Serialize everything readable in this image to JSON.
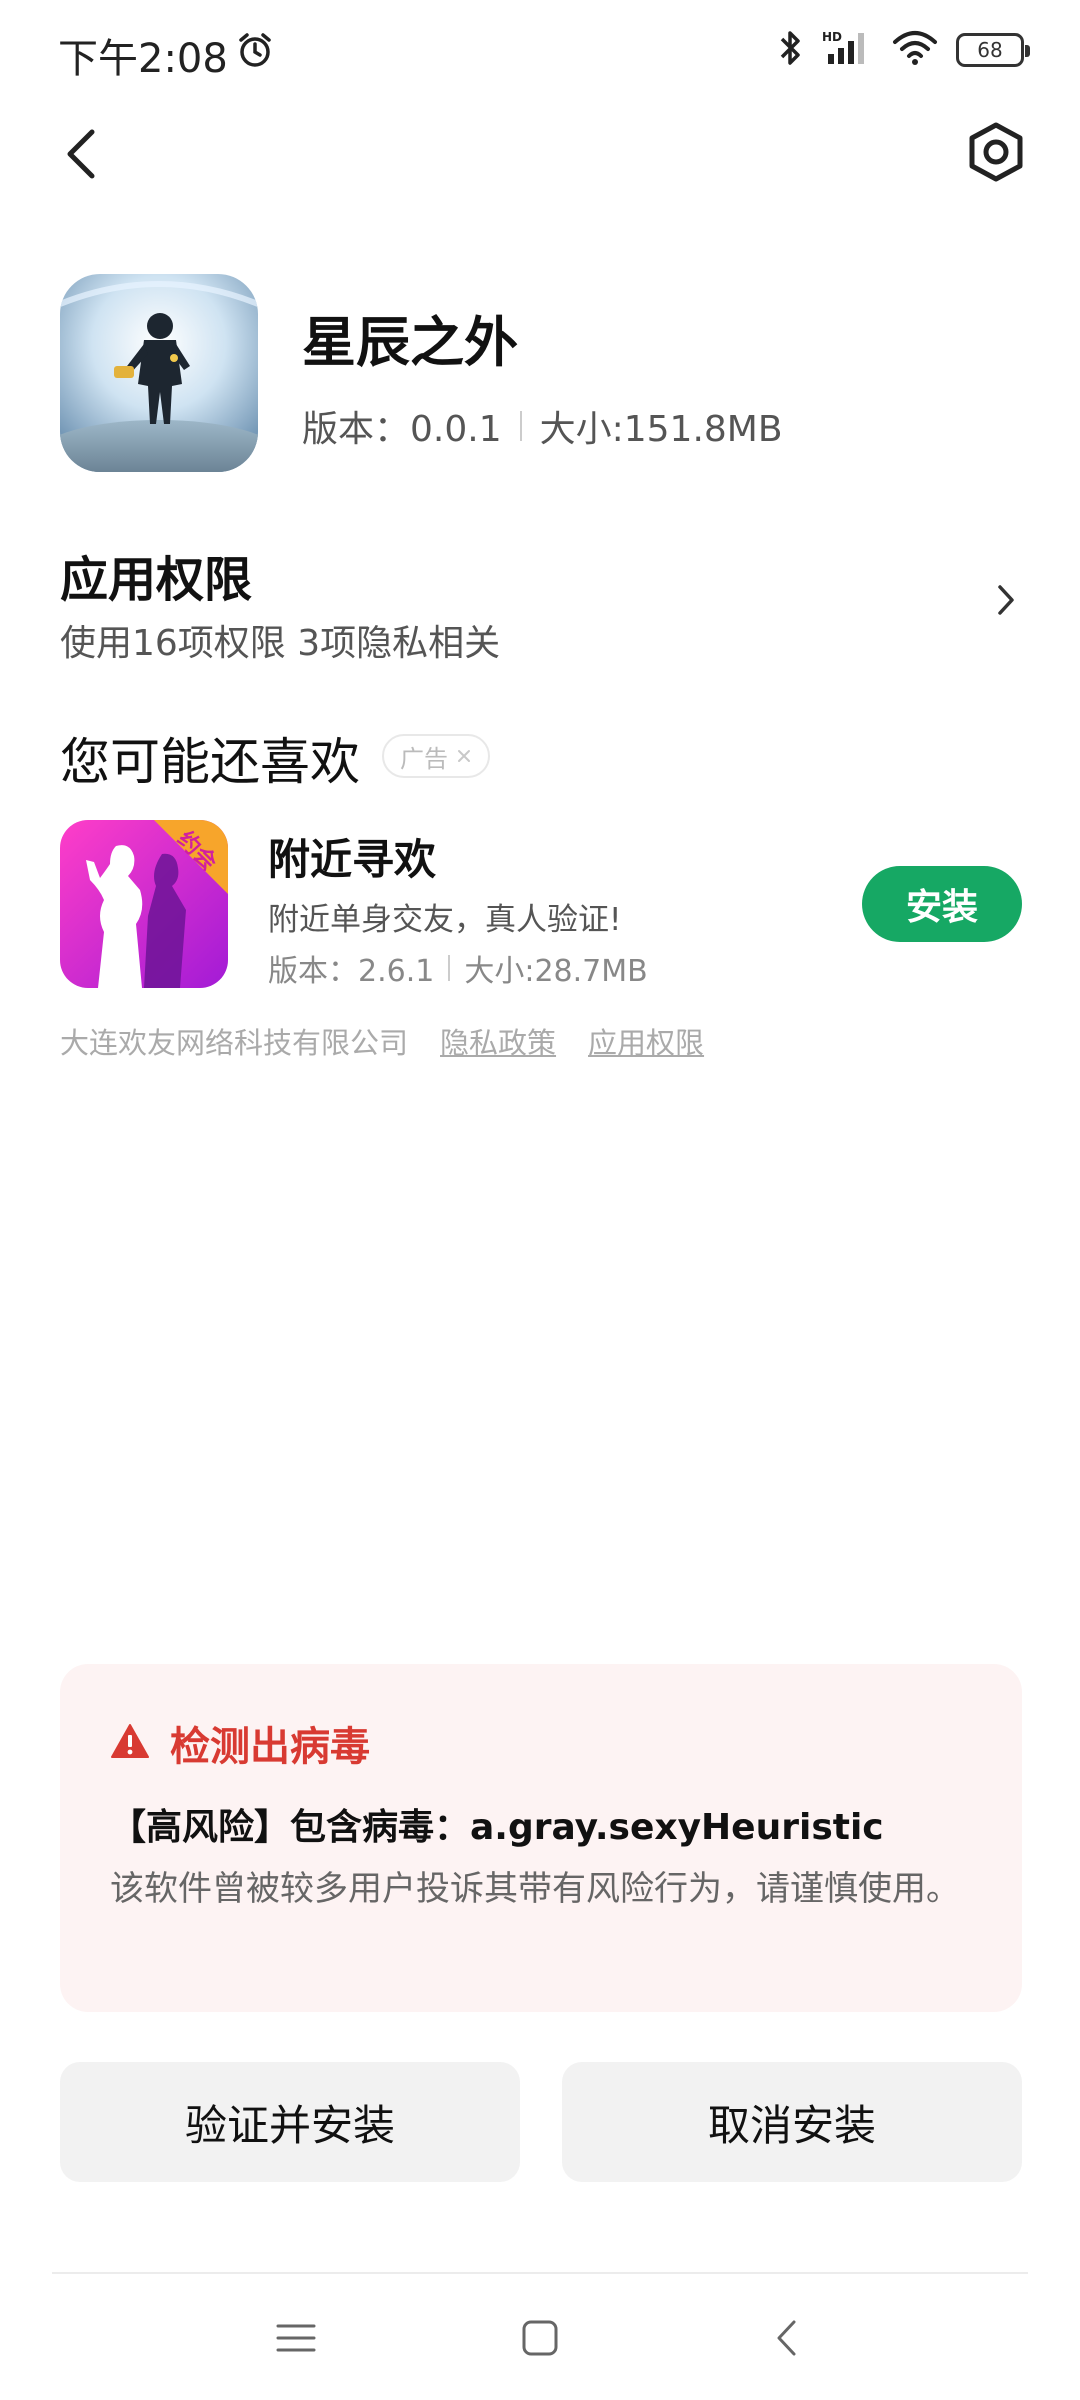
{
  "status_bar": {
    "time": "下午2:08",
    "battery": "68"
  },
  "app": {
    "name": "星辰之外",
    "version": "版本：0.0.1",
    "size": "大小:151.8MB"
  },
  "permissions": {
    "title": "应用权限",
    "summary": "使用16项权限 3项隐私相关"
  },
  "recommend": {
    "title": "您可能还喜欢",
    "ad_label": "广告",
    "item": {
      "name": "附近寻欢",
      "icon_tag": "约会",
      "description": "附近单身交友，真人验证!",
      "version": "版本：2.6.1",
      "size": "大小:28.7MB",
      "install_label": "安装"
    },
    "developer": "大连欢友网络科技有限公司",
    "privacy_link": "隐私政策",
    "permission_link": "应用权限"
  },
  "warning": {
    "title": "检测出病毒",
    "detail": "【高风险】包含病毒：a.gray.sexyHeuristic",
    "description": "该软件曾被较多用户投诉其带有风险行为，请谨慎使用。",
    "accent_color": "#d83a32"
  },
  "actions": {
    "verify_install": "验证并安装",
    "cancel_install": "取消安装"
  },
  "colors": {
    "install_button": "#16a864",
    "warning_bg": "#fdf3f3"
  }
}
